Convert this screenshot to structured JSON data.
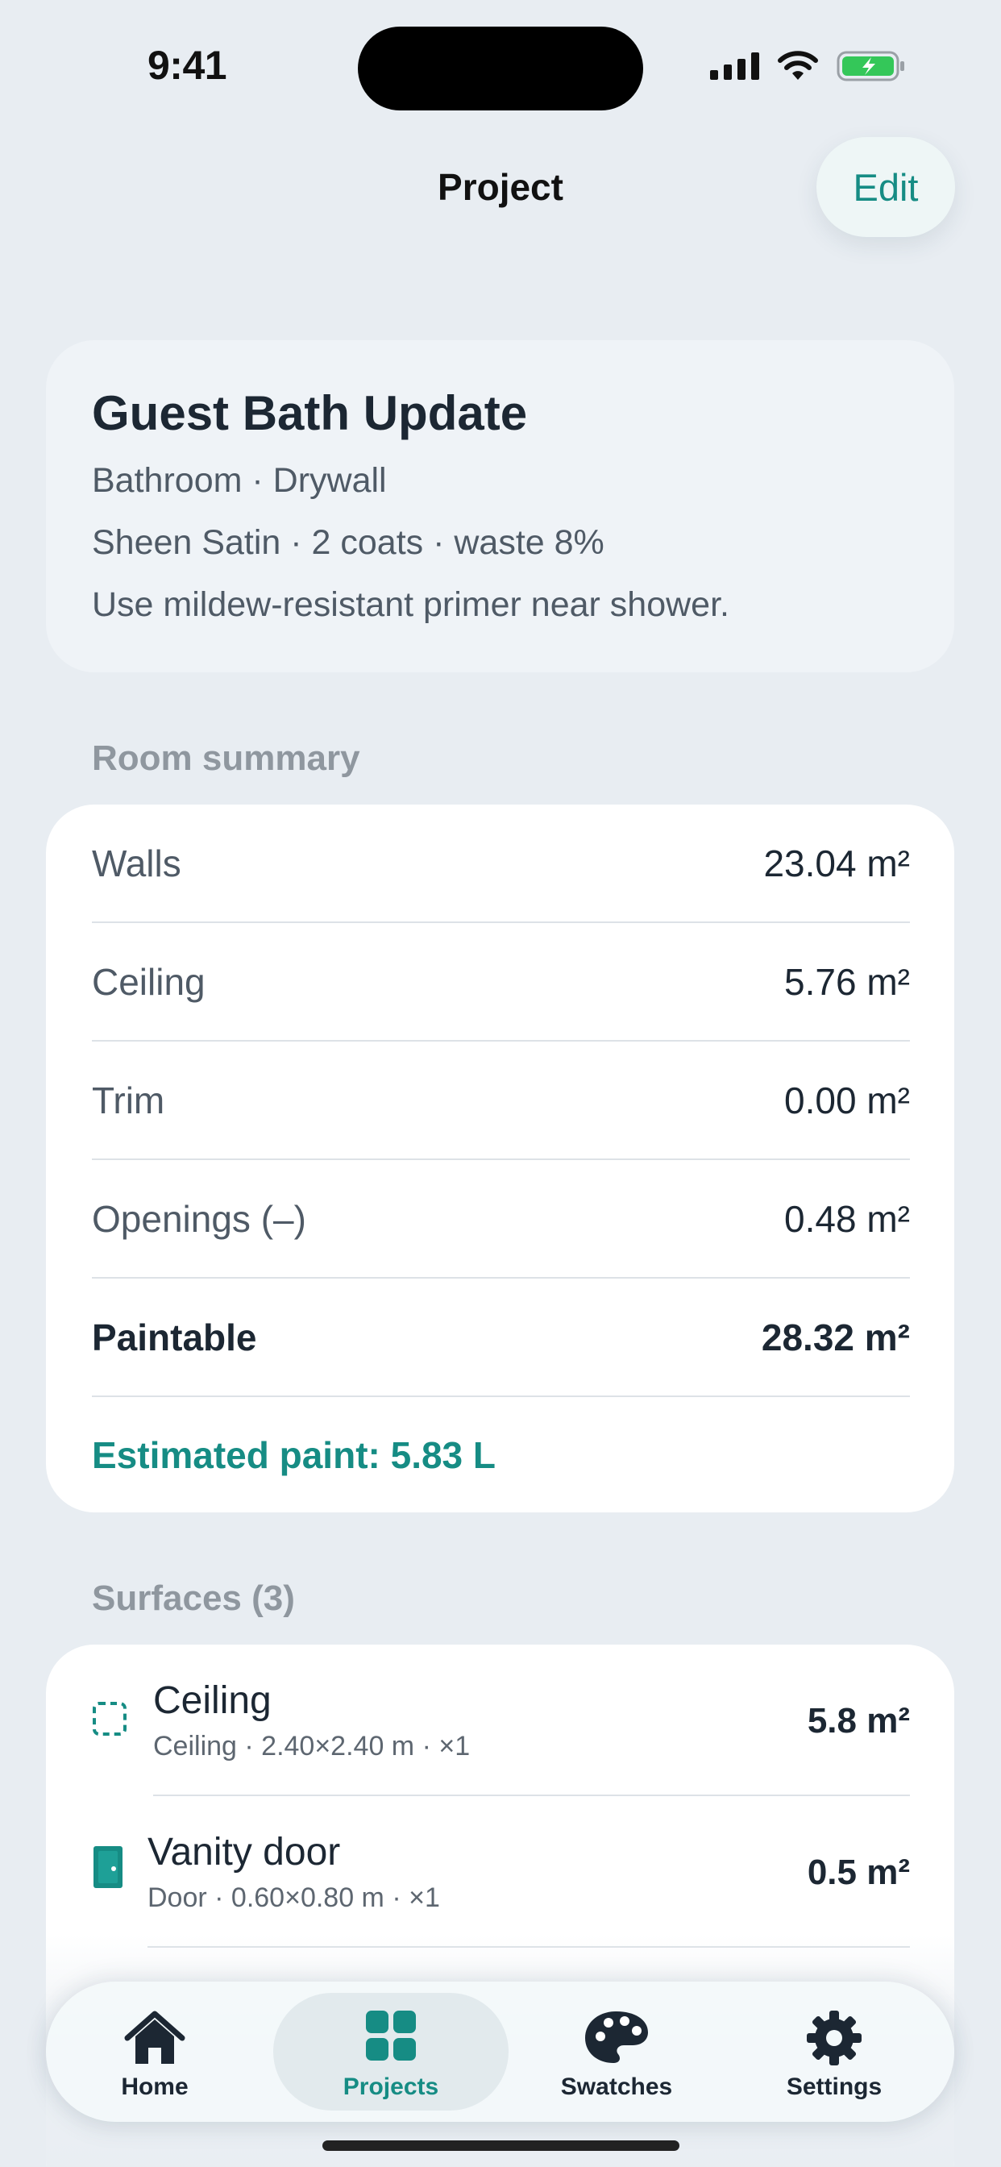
{
  "status_bar": {
    "time": "9:41"
  },
  "nav": {
    "title": "Project",
    "edit_label": "Edit"
  },
  "project": {
    "name": "Guest Bath Update",
    "room_line": "Bathroom · Drywall",
    "finish_line": "Sheen Satin · 2 coats · waste 8%",
    "note": "Use mildew-resistant primer near shower."
  },
  "room_summary": {
    "label": "Room summary",
    "rows": [
      {
        "label": "Walls",
        "value": "23.04 m²"
      },
      {
        "label": "Ceiling",
        "value": "5.76 m²"
      },
      {
        "label": "Trim",
        "value": "0.00 m²"
      },
      {
        "label": "Openings (–)",
        "value": "0.48 m²"
      },
      {
        "label": "Paintable",
        "value": "28.32 m²"
      }
    ],
    "estimate": "Estimated paint: 5.83 L"
  },
  "surfaces": {
    "label": "Surfaces (3)",
    "items": [
      {
        "name": "Ceiling",
        "detail": "Ceiling · 2.40×2.40 m · ×1",
        "area": "5.8 m²",
        "icon": "ceiling-outline-icon"
      },
      {
        "name": "Vanity door",
        "detail": "Door · 0.60×0.80 m · ×1",
        "area": "0.5 m²",
        "icon": "door-icon"
      }
    ]
  },
  "tabs": [
    {
      "label": "Home",
      "icon": "house-icon",
      "active": false
    },
    {
      "label": "Projects",
      "icon": "grid-icon",
      "active": true
    },
    {
      "label": "Swatches",
      "icon": "palette-icon",
      "active": false
    },
    {
      "label": "Settings",
      "icon": "gear-icon",
      "active": false
    }
  ],
  "colors": {
    "accent": "#168c84",
    "background": "#e8edf2",
    "text": "#1c2733"
  }
}
